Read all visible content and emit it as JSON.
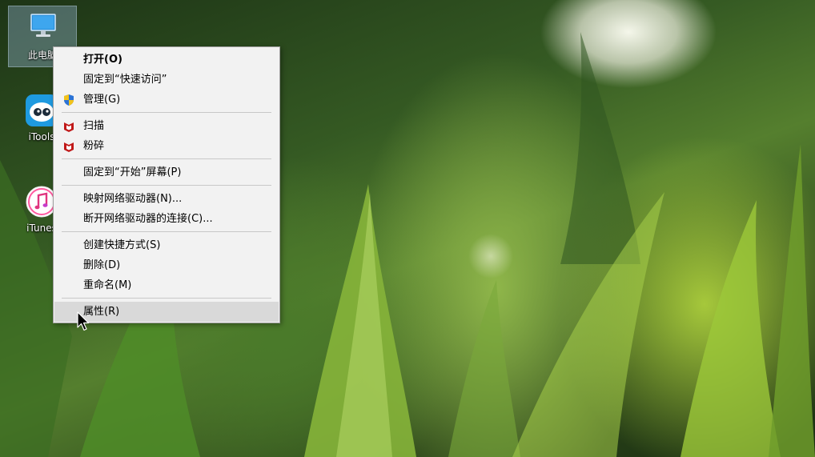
{
  "desktop": {
    "icons": [
      {
        "label": "此电脑",
        "icon": "computer-icon"
      },
      {
        "label": "iTools",
        "icon": "itools-icon"
      },
      {
        "label": "iTunes",
        "icon": "itunes-icon"
      }
    ]
  },
  "context_menu": {
    "items": [
      {
        "label": "打开(O)",
        "bold": true
      },
      {
        "label": "固定到“快速访问”"
      },
      {
        "label": "管理(G)",
        "icon": "uac-shield-icon"
      },
      {
        "label": "扫描",
        "icon": "mcafee-icon"
      },
      {
        "label": "粉碎",
        "icon": "mcafee-icon"
      },
      {
        "label": "固定到“开始”屏幕(P)"
      },
      {
        "label": "映射网络驱动器(N)..."
      },
      {
        "label": "断开网络驱动器的连接(C)..."
      },
      {
        "label": "创建快捷方式(S)"
      },
      {
        "label": "删除(D)"
      },
      {
        "label": "重命名(M)"
      },
      {
        "label": "属性(R)",
        "highlighted": true
      }
    ]
  },
  "colors": {
    "menu_bg": "#f2f2f2",
    "menu_highlight": "#d9d9d9",
    "mcafee_red": "#c01818",
    "itools_blue": "#1e9ae0"
  }
}
